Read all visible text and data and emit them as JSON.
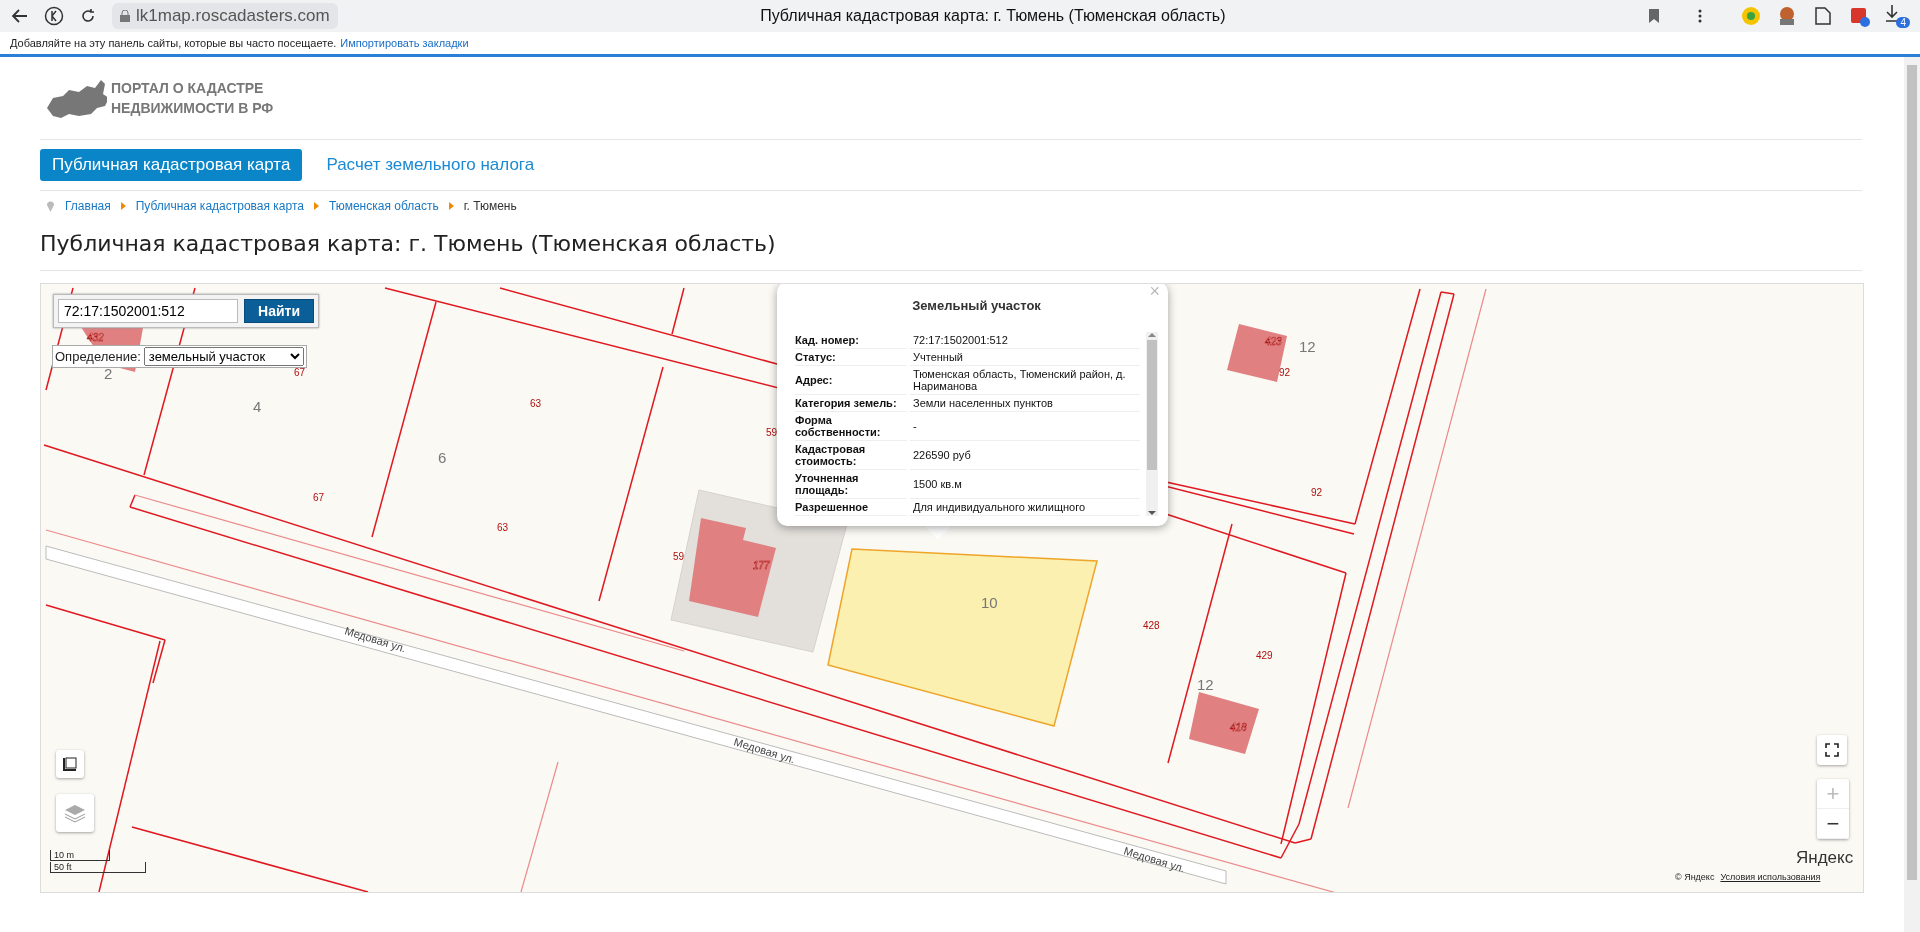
{
  "browser": {
    "url": "lk1map.roscadasters.com",
    "tab_title": "Публичная кадастровая карта: г. Тюмень (Тюменская область)",
    "download_badge": "4"
  },
  "bookmarks_bar": {
    "text": "Добавляйте на эту панель сайты, которые вы часто посещаете.",
    "link": "Импортировать закладки"
  },
  "site": {
    "logo_lines": [
      "ПОРТАЛ О КАДАСТРЕ",
      "НЕДВИЖИМОСТИ В РФ"
    ]
  },
  "nav": [
    {
      "label": "Публичная кадастровая карта",
      "selected": true
    },
    {
      "label": "Расчет земельного налога",
      "selected": false
    }
  ],
  "breadcrumbs": [
    {
      "label": "Главная",
      "kind": "link"
    },
    {
      "label": "Публичная кадастровая карта",
      "kind": "link"
    },
    {
      "label": "Тюменская область",
      "kind": "link"
    },
    {
      "label": "г. Тюмень",
      "kind": "current"
    }
  ],
  "page_title": "Публичная кадастровая карта: г. Тюмень (Тюменская область)",
  "map": {
    "search": {
      "value": "72:17:1502001:512",
      "button": "Найти"
    },
    "definition": {
      "label": "Определение:",
      "value": "земельный участок"
    },
    "popup": {
      "title": "Земельный участок",
      "close": "×",
      "rows": [
        {
          "label": "Кад. номер:",
          "value": "72:17:1502001:512"
        },
        {
          "label": "Статус:",
          "value": "Учтенный"
        },
        {
          "label": "Адрес:",
          "value": "Тюменская область, Тюменский район, д. Нариманова"
        },
        {
          "label": "Категория земель:",
          "value": "Земли населенных пунктов"
        },
        {
          "label": "Форма собственности:",
          "value": "-"
        },
        {
          "label": "Кадастровая стоимость:",
          "value": "226590 руб"
        },
        {
          "label": "Уточненная площадь:",
          "value": "1500 кв.м"
        },
        {
          "label": "Разрешенное",
          "value": "Для индивидуального жилищного"
        }
      ]
    },
    "labels": [
      {
        "text": "432",
        "kind": "building"
      },
      {
        "text": "2",
        "kind": "plot"
      },
      {
        "text": "67",
        "kind": "number"
      },
      {
        "text": "4",
        "kind": "plot"
      },
      {
        "text": "63",
        "kind": "number"
      },
      {
        "text": "6",
        "kind": "plot"
      },
      {
        "text": "67",
        "kind": "number"
      },
      {
        "text": "63",
        "kind": "number"
      },
      {
        "text": "59",
        "kind": "number"
      },
      {
        "text": "59",
        "kind": "number"
      },
      {
        "text": "177",
        "kind": "building"
      },
      {
        "text": "10",
        "kind": "plot"
      },
      {
        "text": "428",
        "kind": "number"
      },
      {
        "text": "429",
        "kind": "number"
      },
      {
        "text": "12",
        "kind": "plot"
      },
      {
        "text": "418",
        "kind": "building"
      },
      {
        "text": "423",
        "kind": "building"
      },
      {
        "text": "12",
        "kind": "plot"
      },
      {
        "text": "92",
        "kind": "number"
      },
      {
        "text": "92",
        "kind": "number"
      },
      {
        "text": "Медовая ул.",
        "kind": "street"
      },
      {
        "text": "Медовая ул.",
        "kind": "street"
      },
      {
        "text": "Медовая ул.",
        "kind": "street"
      }
    ],
    "scale": [
      "10 m",
      "50 ft"
    ],
    "zoom": [
      "+",
      "−"
    ],
    "logo": "Яндекс",
    "copyright": "© Яндекс",
    "terms": "Условия использования"
  }
}
